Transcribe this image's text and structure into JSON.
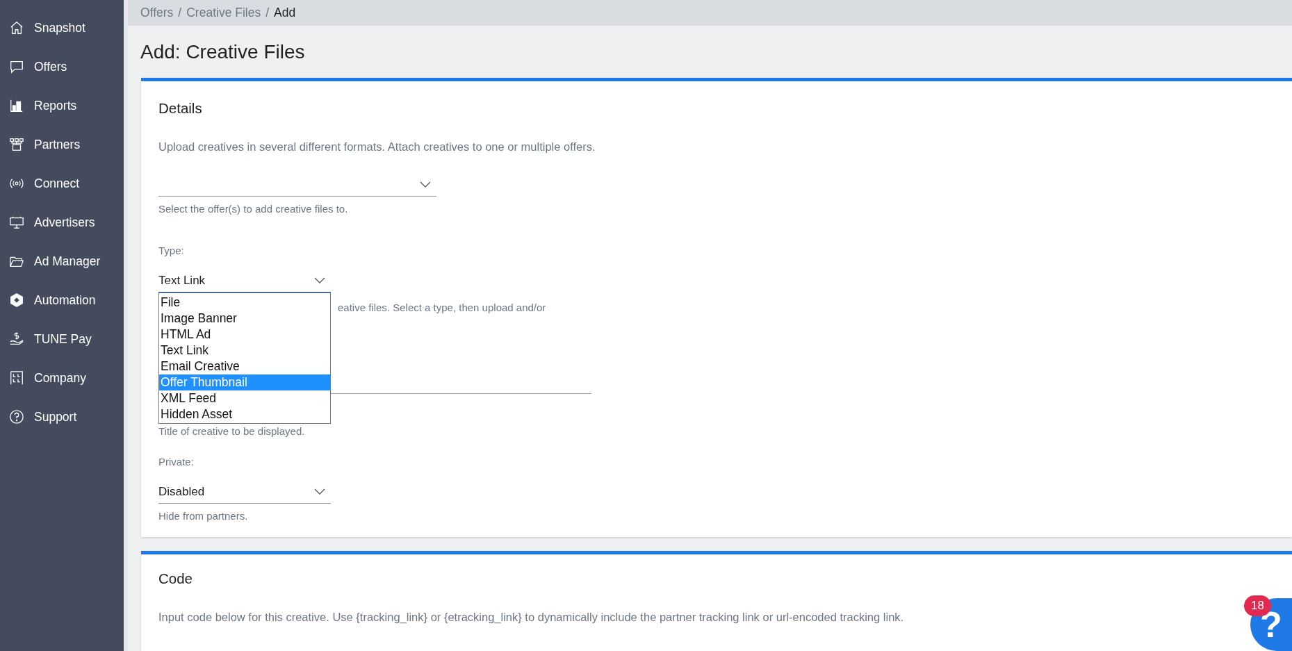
{
  "sidebar": {
    "items": [
      {
        "label": "Snapshot"
      },
      {
        "label": "Offers"
      },
      {
        "label": "Reports"
      },
      {
        "label": "Partners"
      },
      {
        "label": "Connect"
      },
      {
        "label": "Advertisers"
      },
      {
        "label": "Ad Manager"
      },
      {
        "label": "Automation"
      },
      {
        "label": "TUNE Pay"
      },
      {
        "label": "Company"
      },
      {
        "label": "Support"
      }
    ]
  },
  "breadcrumb": [
    {
      "label": "Offers",
      "current": false
    },
    {
      "label": "Creative Files",
      "current": false
    },
    {
      "label": "Add",
      "current": true
    }
  ],
  "breadcrumb_separator": "/",
  "page_title": "Add: Creative Files",
  "details": {
    "heading": "Details",
    "description": "Upload creatives in several different formats. Attach creatives to one or multiple offers.",
    "offer_select": {
      "help": "Select the offer(s) to add creative files to."
    },
    "type_select": {
      "label": "Type:",
      "value": "Text Link",
      "expanded": true,
      "help": "eative files. Select a type, then upload and/or",
      "options": [
        {
          "label": "File",
          "highlighted": false
        },
        {
          "label": "Image Banner",
          "highlighted": false
        },
        {
          "label": "HTML Ad",
          "highlighted": false
        },
        {
          "label": "Text Link",
          "highlighted": false
        },
        {
          "label": "Email Creative",
          "highlighted": false
        },
        {
          "label": "Offer Thumbnail",
          "highlighted": true
        },
        {
          "label": "XML Feed",
          "highlighted": false
        },
        {
          "label": "Hidden Asset",
          "highlighted": false
        }
      ]
    },
    "name_field": {
      "help": "Title of creative to be displayed."
    },
    "private_select": {
      "label": "Private:",
      "value": "Disabled",
      "help": "Hide from partners."
    }
  },
  "code": {
    "heading": "Code",
    "description": "Input code below for this creative. Use {tracking_link} or {etracking_link} to dynamically include the partner tracking link or url-encoded tracking link."
  },
  "help_button": {
    "glyph": "?",
    "badge": "18"
  }
}
